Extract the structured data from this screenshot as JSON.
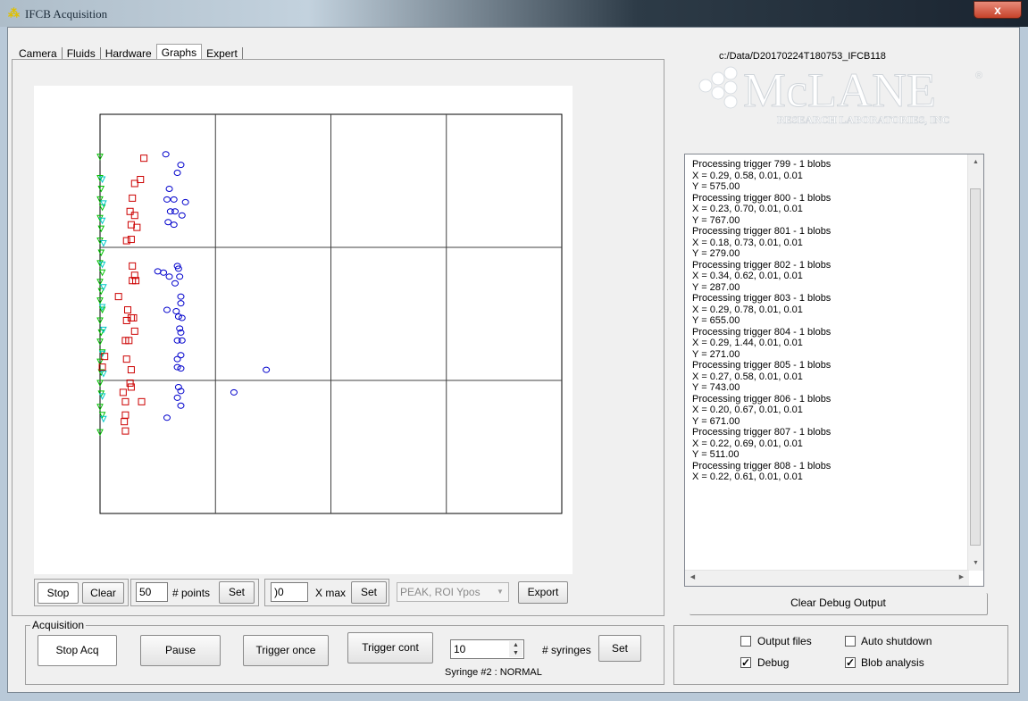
{
  "window": {
    "title": "IFCB Acquisition",
    "close_glyph": "x"
  },
  "tabs": [
    "Camera",
    "Fluids",
    "Hardware",
    "Graphs",
    "Expert"
  ],
  "active_tab": "Graphs",
  "data_path": "c:/Data/D20170224T180753_IFCB118",
  "logo": {
    "brand": "McLANE",
    "registered": "®",
    "tagline": "RESEARCH LABORATORIES, INC"
  },
  "graph_controls": {
    "stop": "Stop",
    "clear": "Clear",
    "points_value": "50",
    "points_label": "# points",
    "points_set": "Set",
    "xmax_value": ")0",
    "xmax_label": "X max",
    "xmax_set": "Set",
    "select_value": "PEAK, ROI Ypos",
    "export": "Export"
  },
  "debug": {
    "lines": [
      "Processing trigger 799 - 1 blobs",
      "X = 0.29, 0.58, 0.01, 0.01",
      "Y = 575.00",
      "Processing trigger 800 - 1 blobs",
      "X = 0.23, 0.70, 0.01, 0.01",
      "Y = 767.00",
      "Processing trigger 801 - 1 blobs",
      "X = 0.18, 0.73, 0.01, 0.01",
      "Y = 279.00",
      "Processing trigger 802 - 1 blobs",
      "X = 0.34, 0.62, 0.01, 0.01",
      "Y = 287.00",
      "Processing trigger 803 - 1 blobs",
      "X = 0.29, 0.78, 0.01, 0.01",
      "Y = 655.00",
      "Processing trigger 804 - 1 blobs",
      "X = 0.29, 1.44, 0.01, 0.01",
      "Y = 271.00",
      "Processing trigger 805 - 1 blobs",
      "X = 0.27, 0.58, 0.01, 0.01",
      "Y = 743.00",
      "Processing trigger 806 - 1 blobs",
      "X = 0.20, 0.67, 0.01, 0.01",
      "Y = 671.00",
      "Processing trigger 807 - 1 blobs",
      "X = 0.22, 0.69, 0.01, 0.01",
      "Y = 511.00",
      "Processing trigger 808 - 1 blobs",
      "X = 0.22, 0.61, 0.01, 0.01"
    ],
    "clear_button": "Clear Debug Output"
  },
  "acquisition": {
    "group_label": "Acquisition",
    "stop_acq": "Stop Acq",
    "pause": "Pause",
    "trigger_once": "Trigger once",
    "trigger_cont": "Trigger cont",
    "syringes_value": "10",
    "syringes_label": "# syringes",
    "set": "Set",
    "syringe_status": "Syringe #2 : NORMAL"
  },
  "options": {
    "output_files": {
      "label": "Output files",
      "checked": false
    },
    "auto_shutdown": {
      "label": "Auto shutdown",
      "checked": false
    },
    "debug": {
      "label": "Debug",
      "checked": true
    },
    "blob_analysis": {
      "label": "Blob analysis",
      "checked": true
    }
  },
  "colors": {
    "series_green": "#00c000",
    "series_cyan": "#00c8c8",
    "series_red": "#cc0000",
    "series_blue": "#0000cc"
  },
  "chart_data": {
    "type": "scatter",
    "xlim": [
      0,
      4
    ],
    "ylim": [
      0,
      3
    ],
    "grid": true,
    "x_gridlines": [
      1,
      2,
      3
    ],
    "y_gridlines": [
      1,
      2
    ],
    "series": [
      {
        "marker": "triangle",
        "color": "#00c000",
        "points": [
          [
            0.0,
            2.68
          ],
          [
            0.0,
            2.52
          ],
          [
            0.01,
            2.44
          ],
          [
            0.0,
            2.36
          ],
          [
            0.02,
            2.3
          ],
          [
            0.0,
            2.22
          ],
          [
            0.01,
            2.14
          ],
          [
            0.0,
            2.05
          ],
          [
            0.01,
            1.96
          ],
          [
            0.0,
            1.88
          ],
          [
            0.02,
            1.81
          ],
          [
            0.0,
            1.74
          ],
          [
            0.01,
            1.67
          ],
          [
            0.0,
            1.6
          ],
          [
            0.02,
            1.53
          ],
          [
            0.0,
            1.45
          ],
          [
            0.01,
            1.36
          ],
          [
            0.0,
            1.29
          ],
          [
            0.02,
            1.21
          ],
          [
            0.0,
            1.14
          ],
          [
            0.01,
            1.06
          ],
          [
            0.0,
            0.98
          ],
          [
            0.01,
            0.9
          ],
          [
            0.0,
            0.8
          ],
          [
            0.02,
            0.74
          ],
          [
            0.0,
            0.61
          ]
        ]
      },
      {
        "marker": "triangle",
        "color": "#00c8c8",
        "points": [
          [
            0.02,
            2.51
          ],
          [
            0.03,
            2.33
          ],
          [
            0.02,
            2.2
          ],
          [
            0.03,
            2.03
          ],
          [
            0.02,
            1.87
          ],
          [
            0.03,
            1.7
          ],
          [
            0.02,
            1.55
          ],
          [
            0.03,
            1.38
          ],
          [
            0.02,
            1.2
          ],
          [
            0.03,
            1.05
          ],
          [
            0.02,
            0.88
          ],
          [
            0.03,
            0.71
          ]
        ]
      },
      {
        "marker": "square",
        "color": "#cc0000",
        "points": [
          [
            0.38,
            2.67
          ],
          [
            0.35,
            2.51
          ],
          [
            0.3,
            2.48
          ],
          [
            0.28,
            2.37
          ],
          [
            0.26,
            2.27
          ],
          [
            0.3,
            2.24
          ],
          [
            0.27,
            2.17
          ],
          [
            0.32,
            2.15
          ],
          [
            0.27,
            2.06
          ],
          [
            0.23,
            2.05
          ],
          [
            0.28,
            1.86
          ],
          [
            0.3,
            1.79
          ],
          [
            0.28,
            1.75
          ],
          [
            0.31,
            1.75
          ],
          [
            0.16,
            1.63
          ],
          [
            0.24,
            1.53
          ],
          [
            0.27,
            1.47
          ],
          [
            0.23,
            1.45
          ],
          [
            0.29,
            1.47
          ],
          [
            0.3,
            1.37
          ],
          [
            0.22,
            1.3
          ],
          [
            0.25,
            1.3
          ],
          [
            0.04,
            1.18
          ],
          [
            0.02,
            1.1
          ],
          [
            0.23,
            1.16
          ],
          [
            0.27,
            1.08
          ],
          [
            0.26,
            0.98
          ],
          [
            0.27,
            0.95
          ],
          [
            0.2,
            0.91
          ],
          [
            0.22,
            0.84
          ],
          [
            0.36,
            0.84
          ],
          [
            0.22,
            0.74
          ],
          [
            0.21,
            0.69
          ],
          [
            0.22,
            0.62
          ]
        ]
      },
      {
        "marker": "circle",
        "color": "#0000cc",
        "points": [
          [
            0.57,
            2.7
          ],
          [
            0.7,
            2.62
          ],
          [
            0.67,
            2.56
          ],
          [
            0.6,
            2.44
          ],
          [
            0.58,
            2.36
          ],
          [
            0.64,
            2.36
          ],
          [
            0.74,
            2.34
          ],
          [
            0.61,
            2.27
          ],
          [
            0.65,
            2.27
          ],
          [
            0.71,
            2.24
          ],
          [
            0.59,
            2.19
          ],
          [
            0.64,
            2.17
          ],
          [
            0.67,
            1.86
          ],
          [
            0.68,
            1.84
          ],
          [
            0.5,
            1.82
          ],
          [
            0.55,
            1.81
          ],
          [
            0.6,
            1.78
          ],
          [
            0.69,
            1.78
          ],
          [
            0.65,
            1.73
          ],
          [
            0.7,
            1.63
          ],
          [
            0.7,
            1.58
          ],
          [
            0.58,
            1.53
          ],
          [
            0.66,
            1.52
          ],
          [
            0.68,
            1.48
          ],
          [
            0.71,
            1.47
          ],
          [
            0.69,
            1.39
          ],
          [
            0.67,
            1.3
          ],
          [
            0.71,
            1.3
          ],
          [
            0.7,
            1.36
          ],
          [
            0.67,
            1.16
          ],
          [
            0.7,
            1.19
          ],
          [
            0.67,
            1.1
          ],
          [
            0.7,
            1.09
          ],
          [
            1.44,
            1.08
          ],
          [
            0.68,
            0.95
          ],
          [
            0.7,
            0.92
          ],
          [
            0.67,
            0.87
          ],
          [
            0.7,
            0.81
          ],
          [
            1.16,
            0.91
          ],
          [
            0.58,
            0.72
          ]
        ]
      }
    ]
  }
}
